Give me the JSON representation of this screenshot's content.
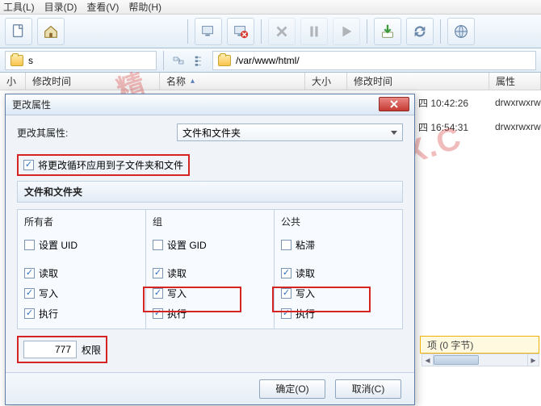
{
  "menu": {
    "tools": "工具(L)",
    "dir": "目录(D)",
    "view": "查看(V)",
    "help": "帮助(H)"
  },
  "address": {
    "left_placeholder": "s",
    "path": "/var/www/html/"
  },
  "columns": {
    "left": {
      "size": "小",
      "mtime": "修改时间"
    },
    "right": {
      "name": "名称",
      "size": "大小",
      "mtime": "修改时间",
      "attr": "属性"
    }
  },
  "rows": [
    {
      "date": "四 10:42:26",
      "perm": "drwxrwxrw"
    },
    {
      "date": "四 16:54:31",
      "perm": "drwxrwxrw"
    }
  ],
  "dialog": {
    "title": "更改属性",
    "change_label": "更改其属性:",
    "select_value": "文件和文件夹",
    "recurse_label": "将更改循环应用到子文件夹和文件",
    "section_title": "文件和文件夹",
    "cols": {
      "owner": "所有者",
      "group": "组",
      "public": "公共",
      "set_uid": "设置 UID",
      "set_gid": "设置 GID",
      "sticky": "粘滞",
      "read": "读取",
      "write": "写入",
      "exec": "执行"
    },
    "numeric_value": "777",
    "numeric_label": "权限",
    "ok": "确定(O)",
    "cancel": "取消(C)"
  },
  "status": {
    "selection": "项 (0 字节)"
  },
  "watermark": {
    "a": "精",
    "b": "WWW.11PX.C"
  }
}
